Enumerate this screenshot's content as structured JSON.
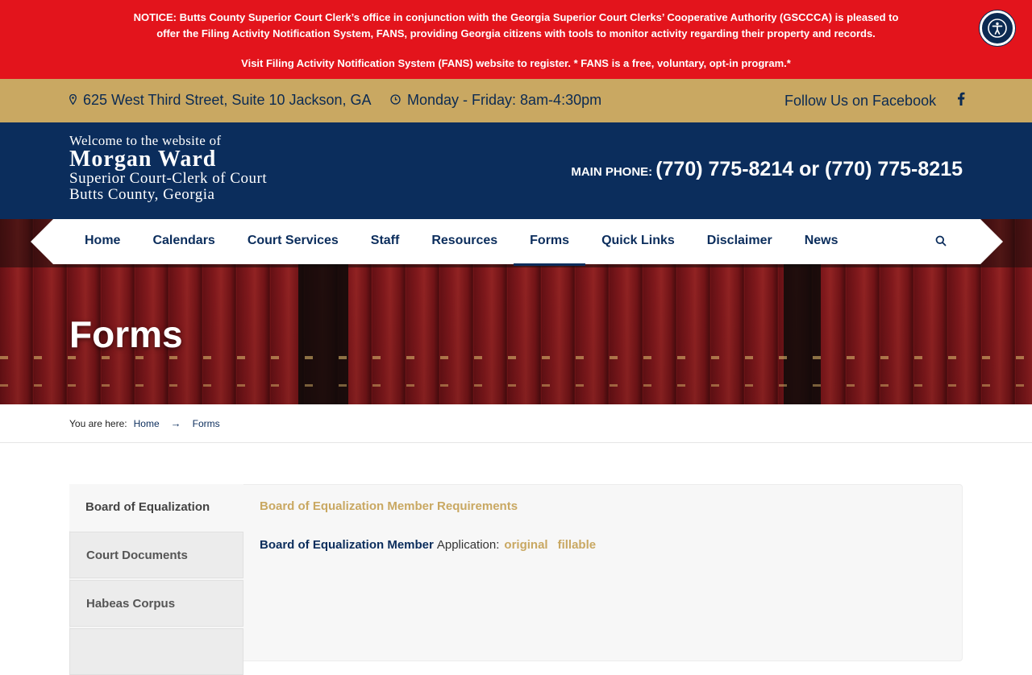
{
  "notice": {
    "line1": "NOTICE: Butts County Superior Court Clerk’s office in conjunction with the Georgia Superior Court Clerks’ Cooperative Authority (GSCCCA) is pleased to offer the Filing Activity Notification System, FANS, providing Georgia citizens with tools to monitor activity regarding their property and records.",
    "line2": "Visit Filing Activity Notification System (FANS) website to register. * FANS is a free, voluntary, opt-in program.*"
  },
  "infobar": {
    "address": "625 West Third Street, Suite 10 Jackson, GA",
    "hours": "Monday - Friday: 8am-4:30pm",
    "facebook": "Follow Us on Facebook"
  },
  "header": {
    "welcome": "Welcome to the website of",
    "name": "Morgan Ward",
    "title1": "Superior Court-Clerk of Court",
    "title2": "Butts County, Georgia",
    "phone_label": "MAIN PHONE:",
    "phone_numbers": "(770) 775-8214 or (770) 775-8215"
  },
  "nav": {
    "items": [
      {
        "label": "Home"
      },
      {
        "label": "Calendars"
      },
      {
        "label": "Court Services"
      },
      {
        "label": "Staff"
      },
      {
        "label": "Resources"
      },
      {
        "label": "Forms"
      },
      {
        "label": "Quick Links"
      },
      {
        "label": "Disclaimer"
      },
      {
        "label": "News"
      }
    ],
    "active": "Forms"
  },
  "hero": {
    "title": "Forms"
  },
  "breadcrumb": {
    "label": "You are here:",
    "home": "Home",
    "arrow": "→",
    "current": "Forms"
  },
  "tabs": [
    {
      "label": "Board of Equalization"
    },
    {
      "label": "Court Documents"
    },
    {
      "label": "Habeas Corpus"
    },
    {
      "label": ""
    }
  ],
  "content": {
    "heading": "Board of Equalization Member Requirements",
    "app_bold": "Board of Equalization Member",
    "app_rest": "Application:",
    "link_original": "original",
    "link_fillable": "fillable"
  },
  "colors": {
    "notice_bg": "#e3141c",
    "gold": "#c9a862",
    "navy": "#0b2d5c"
  }
}
